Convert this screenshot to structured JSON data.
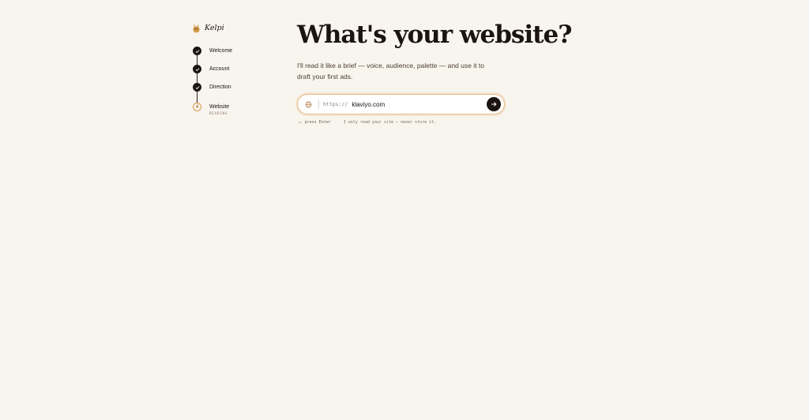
{
  "brand": {
    "name": "Kelpi",
    "icon": "kelpi-logo-icon"
  },
  "steps": [
    {
      "label": "Welcome",
      "state": "done"
    },
    {
      "label": "Account",
      "state": "done"
    },
    {
      "label": "Direction",
      "state": "done"
    },
    {
      "label": "Website",
      "state": "current",
      "number": "4",
      "sub": "READING"
    }
  ],
  "main": {
    "title": "What's your website?",
    "subtitle": "I'll read it like a brief — voice, audience, palette — and use it to draft your first ads.",
    "url_field": {
      "scheme": "https://",
      "value": "klaviyo.com",
      "icon": "globe-icon"
    },
    "submit_icon": "arrow-right-icon",
    "hint": {
      "enter_icon": "↵",
      "enter_label": "press Enter",
      "note": "I only read your site — never store it."
    }
  },
  "colors": {
    "background": "#f8f4ee",
    "ink": "#1c1410",
    "accent": "#d79c55"
  }
}
